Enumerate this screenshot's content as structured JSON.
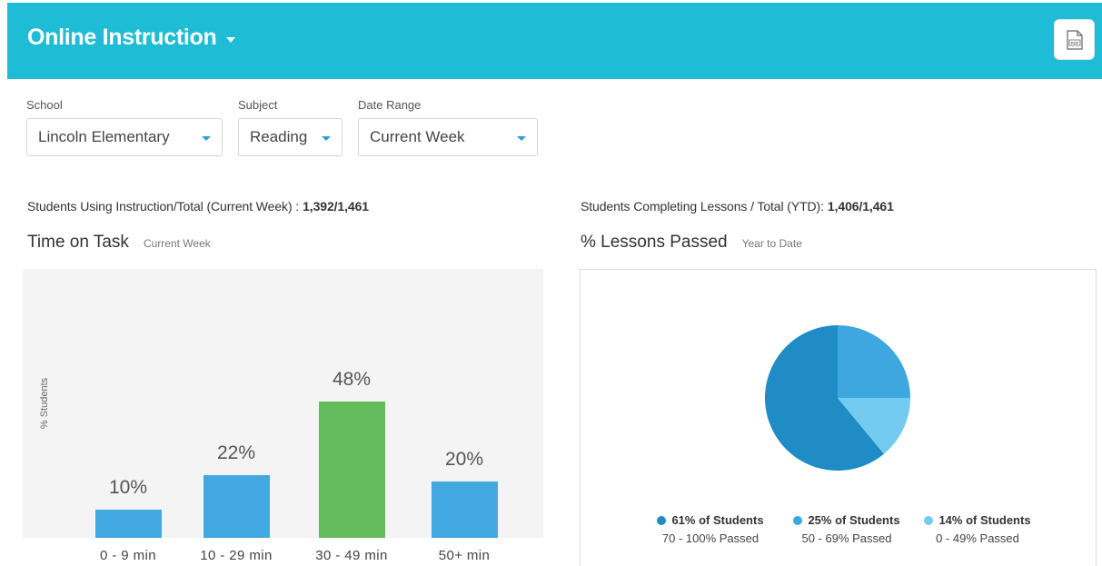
{
  "header": {
    "title": "Online Instruction",
    "export_icon": "pdf-export-icon"
  },
  "filters": {
    "school": {
      "label": "School",
      "value": "Lincoln Elementary"
    },
    "subject": {
      "label": "Subject",
      "value": "Reading"
    },
    "date_range": {
      "label": "Date Range",
      "value": "Current Week"
    }
  },
  "stats": {
    "instruction": {
      "label": "Students Using Instruction/Total (Current Week) :",
      "value": "1,392/1,461"
    },
    "lessons": {
      "label": "Students Completing Lessons / Total (YTD):",
      "value": "1,406/1,461"
    }
  },
  "time_on_task": {
    "title": "Time on Task",
    "subtitle": "Current Week"
  },
  "lessons_passed": {
    "title": "% Lessons Passed",
    "subtitle": "Year to Date"
  },
  "colors": {
    "header": "#1ebcd5",
    "bar": "#42a8e1",
    "bar_highlight": "#64bc5c",
    "pie_1": "#1f8cc6",
    "pie_2": "#3ea7e0",
    "pie_3": "#74cbf1"
  },
  "chart_data": [
    {
      "type": "bar",
      "title": "Time on Task",
      "ylabel": "% Students",
      "categories": [
        "0 - 9 min",
        "10 - 29 min",
        "30 - 49 min",
        "50+ min"
      ],
      "values": [
        10,
        22,
        48,
        20
      ],
      "value_labels": [
        "10%",
        "22%",
        "48%",
        "20%"
      ],
      "highlight_index": 2,
      "ylim": [
        0,
        100
      ],
      "grid": false
    },
    {
      "type": "pie",
      "title": "% Lessons Passed",
      "slices": [
        {
          "label": "61% of Students",
          "sublabel": "70 - 100% Passed",
          "value": 61
        },
        {
          "label": "25% of Students",
          "sublabel": "50 - 69% Passed",
          "value": 25
        },
        {
          "label": "14% of Students",
          "sublabel": "0 - 49% Passed",
          "value": 14
        }
      ],
      "legend": "bottom"
    }
  ]
}
